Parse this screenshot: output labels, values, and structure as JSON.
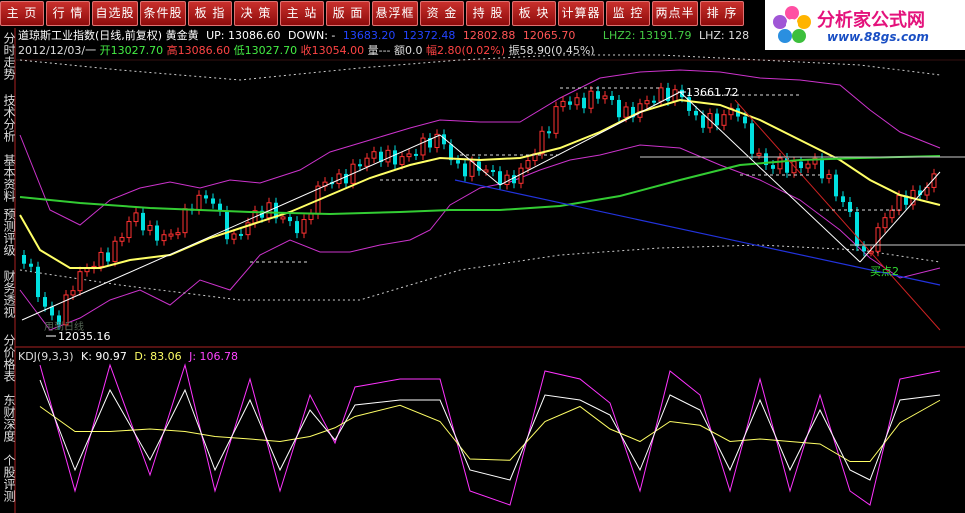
{
  "toolbar": {
    "buttons": [
      "主 页",
      "行 情",
      "自选股",
      "条件股",
      "板 指",
      "决 策",
      "主 站",
      "版 面",
      "悬浮框",
      "资 金",
      "持 股",
      "板 块",
      "计算器",
      "监 控",
      "两点半",
      "排 序"
    ]
  },
  "logo": {
    "title": "分析家公式网",
    "url": "www.88gs.com"
  },
  "side_tabs": [
    "分时走势",
    "技术分析",
    "基本资料",
    "预测评级",
    "财务透视",
    "分价格表",
    "东财深度",
    "个股评测"
  ],
  "header": {
    "title": "道琼斯工业指数(日线,前复权)",
    "indicator": "黄金黄",
    "up": "UP: 13086.60",
    "down": "DOWN: -",
    "lvl1": "13683.20",
    "lvl2": "12372.48",
    "lvl3": "12802.88",
    "lvl4": "12065.70",
    "lhz2": "LHZ2: 13191.79",
    "lhz": "LHZ: 128"
  },
  "quote": {
    "date": "2012/12/03/一",
    "open": "开13027.70",
    "high": "高13086.60",
    "low": "低13027.70",
    "close": "收13054.00",
    "volume": "量---",
    "amount": "额0.0",
    "change": "幅2.80(0.02%)",
    "amplitude": "振58.90(0.45%)"
  },
  "annotations": {
    "high_label": "13661.72",
    "low_label": "12035.16",
    "buy_label": "买点2",
    "faint_label": "用到日线"
  },
  "kdj": {
    "label": "KDJ(9,3,3)",
    "k": "K: 90.97",
    "d": "D: 83.06",
    "j": "J: 106.78"
  },
  "colors": {
    "up": "#ff3232",
    "down": "#00e0e0",
    "ma_yellow": "#ffff66",
    "ma_green": "#33cc33",
    "band_purple": "#cc33cc",
    "band_white": "#cccccc",
    "line_blue": "#2233dd",
    "line_red": "#cc2222",
    "k_line": "#ffffff",
    "d_line": "#ffff66",
    "j_line": "#ff33ff"
  }
}
